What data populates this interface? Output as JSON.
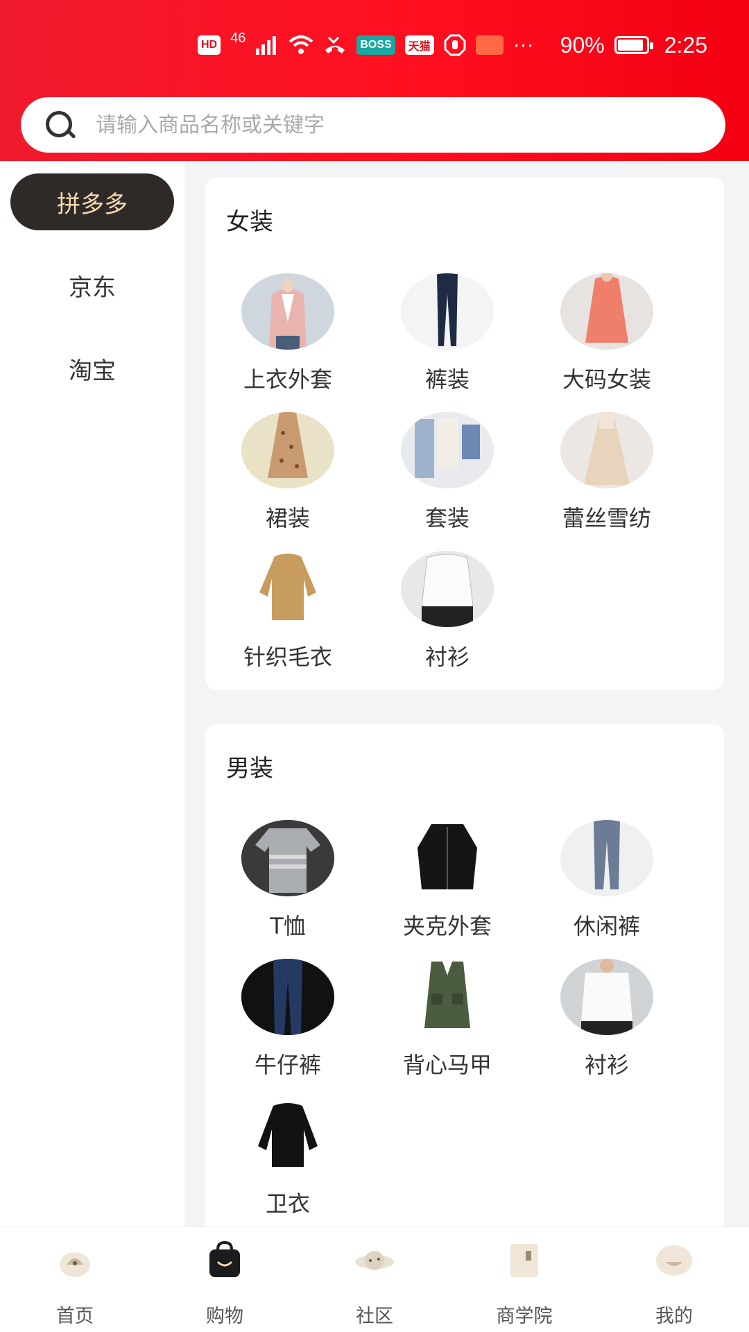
{
  "status_bar": {
    "network": "46",
    "battery": "90%",
    "battery_level": 0.9,
    "time": "2:25",
    "hd_badge": "HD",
    "boss_badge": "BOSS",
    "tmall_badge": "天猫",
    "more": "···"
  },
  "search": {
    "placeholder": "请输入商品名称或关键字",
    "value": ""
  },
  "sidebar": {
    "items": [
      {
        "label": "拼多多",
        "active": true
      },
      {
        "label": "京东",
        "active": false
      },
      {
        "label": "淘宝",
        "active": false
      }
    ]
  },
  "sections": [
    {
      "title": "女装",
      "categories": [
        {
          "label": "上衣外套",
          "icon": "jacket-thumb-icon"
        },
        {
          "label": "裤装",
          "icon": "trousers-thumb-icon"
        },
        {
          "label": "大码女装",
          "icon": "plus-size-dress-thumb-icon"
        },
        {
          "label": "裙装",
          "icon": "floral-dress-thumb-icon"
        },
        {
          "label": "套装",
          "icon": "outfit-set-thumb-icon"
        },
        {
          "label": "蕾丝雪纺",
          "icon": "lace-chiffon-thumb-icon"
        },
        {
          "label": "针织毛衣",
          "icon": "knit-sweater-thumb-icon"
        },
        {
          "label": "衬衫",
          "icon": "blouse-thumb-icon"
        }
      ]
    },
    {
      "title": "男装",
      "categories": [
        {
          "label": "T恤",
          "icon": "tshirt-thumb-icon"
        },
        {
          "label": "夹克外套",
          "icon": "leather-jacket-thumb-icon"
        },
        {
          "label": "休闲裤",
          "icon": "casual-pants-thumb-icon"
        },
        {
          "label": "牛仔裤",
          "icon": "jeans-thumb-icon"
        },
        {
          "label": "背心马甲",
          "icon": "vest-thumb-icon"
        },
        {
          "label": "衬衫",
          "icon": "shirt-thumb-icon"
        },
        {
          "label": "卫衣",
          "icon": "sweatshirt-thumb-icon"
        }
      ]
    }
  ],
  "bottom_nav": {
    "items": [
      {
        "label": "首页",
        "icon": "home-icon"
      },
      {
        "label": "购物",
        "icon": "shopping-bag-icon",
        "active": true
      },
      {
        "label": "社区",
        "icon": "planet-icon"
      },
      {
        "label": "商学院",
        "icon": "book-icon"
      },
      {
        "label": "我的",
        "icon": "profile-icon"
      }
    ]
  },
  "colors": {
    "header_red": "#f01a2d",
    "active_tab_bg": "#2f2a27",
    "active_tab_text": "#f5d9b2"
  }
}
